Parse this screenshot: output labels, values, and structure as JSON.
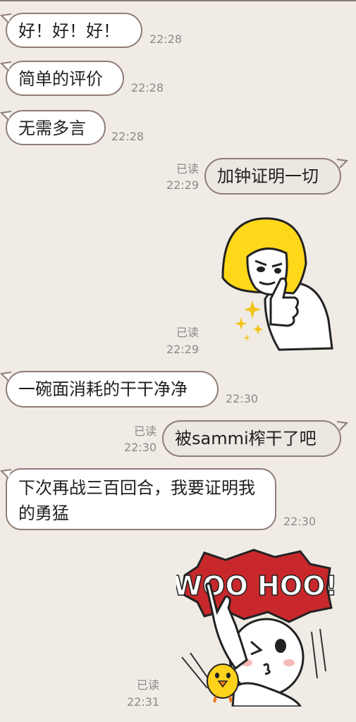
{
  "messages": [
    {
      "text": "好！好！好！",
      "time": "22:28",
      "side": "left"
    },
    {
      "text": "简单的评价",
      "time": "22:28",
      "side": "left"
    },
    {
      "text": "无需多言",
      "time": "22:28",
      "side": "left"
    },
    {
      "text": "加钟证明一切",
      "time": "22:29",
      "side": "right",
      "status": "已读"
    },
    {
      "sticker": "blonde-girl-thumbs-up-sticker",
      "time": "22:29",
      "side": "right",
      "status": "已读"
    },
    {
      "text": "一碗面消耗的干干净净",
      "time": "22:30",
      "side": "left"
    },
    {
      "text": "被sammi榨干了吧",
      "time": "22:30",
      "side": "right",
      "status": "已读"
    },
    {
      "text": "下次再战三百回合，我要证明我的勇猛",
      "time": "22:30",
      "side": "left"
    },
    {
      "sticker": "woo-hoo-sticker",
      "sticker_text": "WOO HOO!",
      "time": "22:31",
      "side": "right",
      "status": "已读"
    }
  ],
  "colors": {
    "background": "#f0ece5",
    "bubble_border": "#8f7c77",
    "sticker_banner": "#c8282b"
  }
}
